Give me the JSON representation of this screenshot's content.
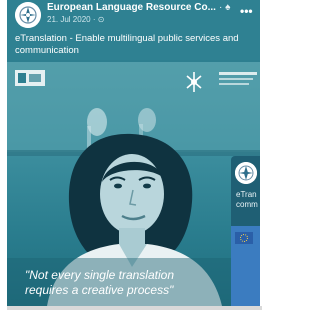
{
  "post": {
    "page_name": "European Language Resource Co...",
    "page_name_trail": "· ♠",
    "date": "21. Jul 2020 · ⊙",
    "more_label": "•••",
    "text": "eTranslation - Enable multilingual public services and communication"
  },
  "video": {
    "quote_line1": "\"Not every single translation",
    "quote_line2": "requires a creative process\""
  },
  "side_card": {
    "text_line1": "eTran",
    "text_line2": "comm"
  },
  "colors": {
    "card_background": "#2d7f90",
    "side_card_media": "#3b7cc0"
  }
}
